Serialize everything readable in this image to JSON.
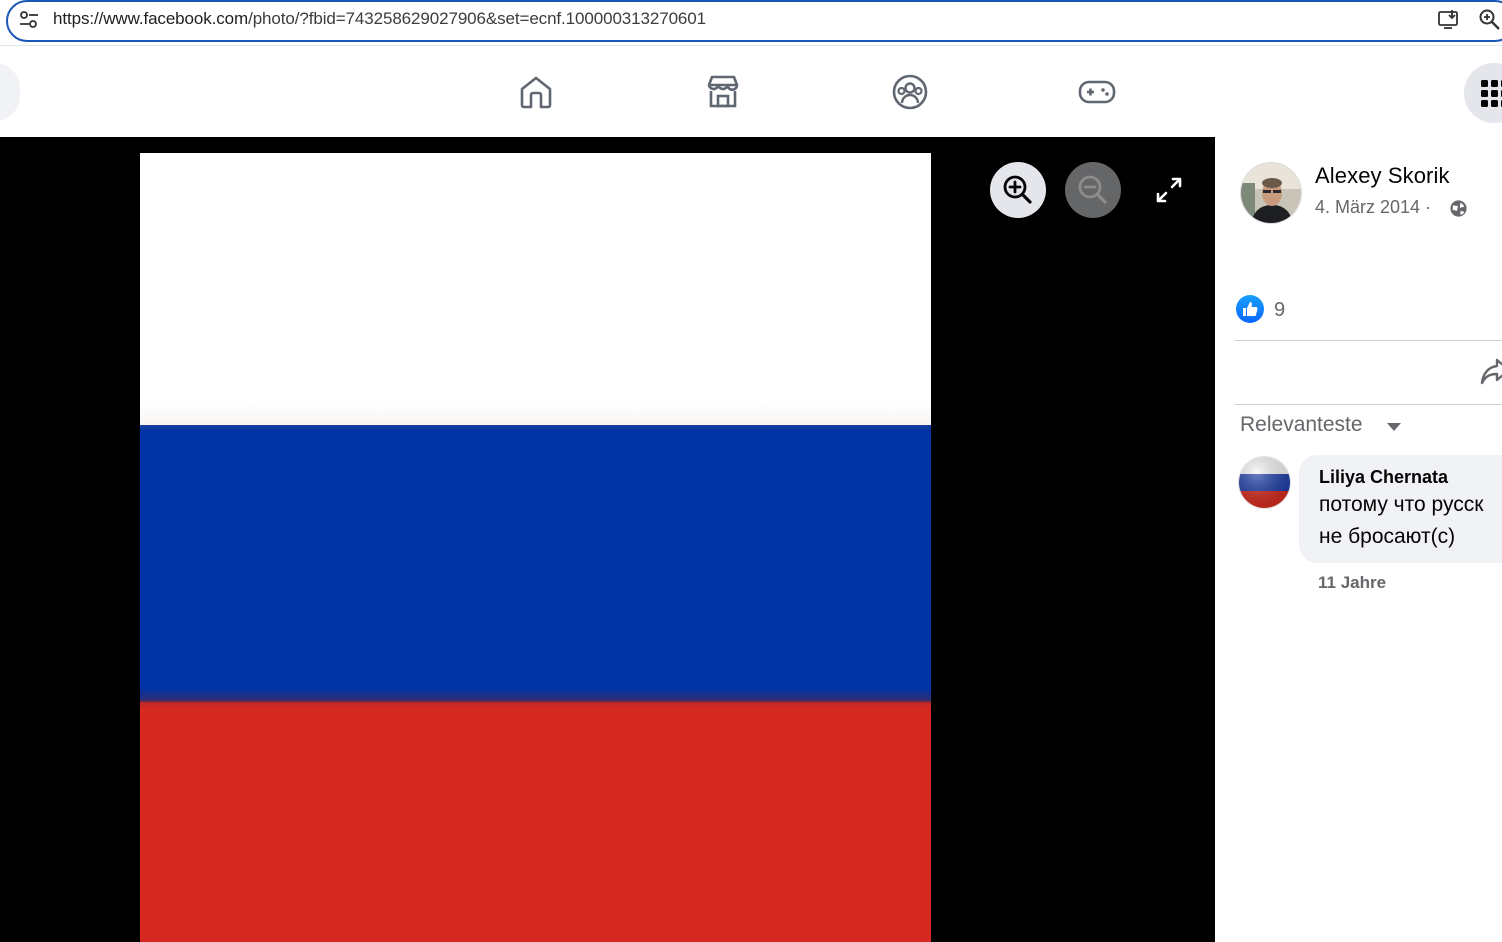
{
  "browser": {
    "url_host": "https://www.facebook.com",
    "url_path": "/photo/?fbid=743258629027906&set=ecnf.100000313270601",
    "accent": "#1a57b8"
  },
  "nav": {
    "icons": [
      "home-icon",
      "marketplace-icon",
      "groups-icon",
      "gaming-icon",
      "menu-grid-icon"
    ]
  },
  "photo": {
    "colors": {
      "white": "#ffffff",
      "blue": "#0033a5",
      "red": "#d5281f"
    },
    "controls": [
      "zoom-in-icon",
      "zoom-out-icon",
      "fullscreen-icon"
    ]
  },
  "post": {
    "author": "Alexey Skorik",
    "date": "4. März 2014 ·",
    "likes": "9",
    "sort_label": "Relevanteste"
  },
  "comments": [
    {
      "author": "Liliya Chernata",
      "line1": "потому что русск",
      "line2": "не бросают(с)",
      "time": "11 Jahre"
    }
  ]
}
